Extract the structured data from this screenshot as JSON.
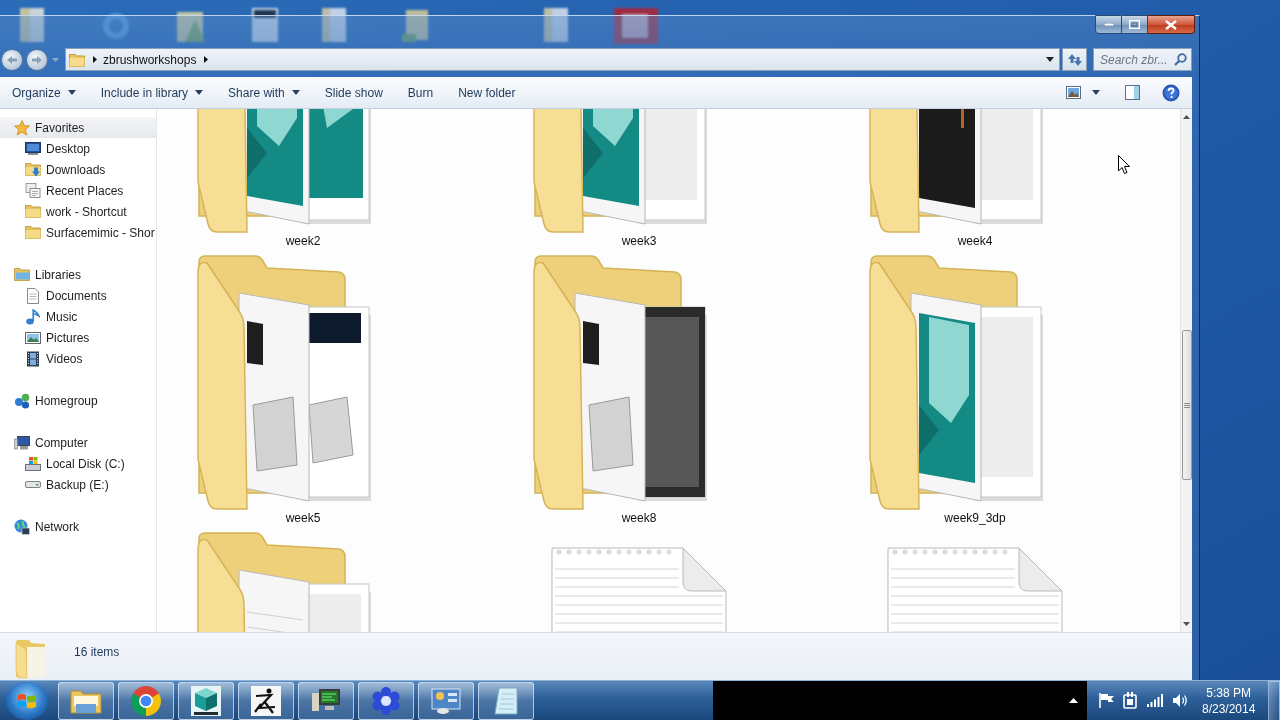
{
  "address_bar": {
    "path": [
      {
        "label": "zbrushworkshops"
      }
    ]
  },
  "search": {
    "placeholder": "Search zbr..."
  },
  "toolbar": {
    "commands": [
      {
        "label": "Organize",
        "dropdown": true
      },
      {
        "label": "Include in library",
        "dropdown": true
      },
      {
        "label": "Share with",
        "dropdown": true
      },
      {
        "label": "Slide show",
        "dropdown": false
      },
      {
        "label": "Burn",
        "dropdown": false
      },
      {
        "label": "New folder",
        "dropdown": false
      }
    ]
  },
  "sidebar": {
    "items": [
      {
        "label": "Favorites",
        "kind": "star",
        "selected": true,
        "children": [
          {
            "label": "Desktop",
            "kind": "desktop",
            "selected": false
          },
          {
            "label": "Downloads",
            "kind": "downloads",
            "selected": false
          },
          {
            "label": "Recent Places",
            "kind": "recent",
            "selected": false
          },
          {
            "label": "work - Shortcut",
            "kind": "folder",
            "selected": false
          },
          {
            "label": "Surfacemimic - Shor",
            "kind": "folder",
            "selected": false
          }
        ]
      },
      {
        "label": "Libraries",
        "kind": "library",
        "selected": false,
        "children": [
          {
            "label": "Documents",
            "kind": "document",
            "selected": false
          },
          {
            "label": "Music",
            "kind": "music",
            "selected": false
          },
          {
            "label": "Pictures",
            "kind": "pictures",
            "selected": false
          },
          {
            "label": "Videos",
            "kind": "videos",
            "selected": false
          }
        ]
      },
      {
        "label": "Homegroup",
        "kind": "homegroup",
        "selected": false
      },
      {
        "label": "Computer",
        "kind": "computer",
        "selected": false,
        "children": [
          {
            "label": "Local Disk (C:)",
            "kind": "system-drive",
            "selected": false
          },
          {
            "label": "Backup (E:)",
            "kind": "drive",
            "selected": false
          }
        ]
      },
      {
        "label": "Network",
        "kind": "network",
        "selected": false
      }
    ]
  },
  "items": [
    {
      "kind": "folder",
      "label": "week2"
    },
    {
      "kind": "folder",
      "label": "week3"
    },
    {
      "kind": "folder",
      "label": "week4"
    },
    {
      "kind": "folder",
      "label": "week5"
    },
    {
      "kind": "folder",
      "label": "week8"
    },
    {
      "kind": "folder",
      "label": "week9_3dp"
    },
    {
      "kind": "folder"
    },
    {
      "kind": "file"
    },
    {
      "kind": "file"
    }
  ],
  "details_pane": {
    "summary": "16 items"
  },
  "taskbar": {
    "clock": {
      "time": "5:38 PM",
      "date": "8/23/2014"
    }
  }
}
